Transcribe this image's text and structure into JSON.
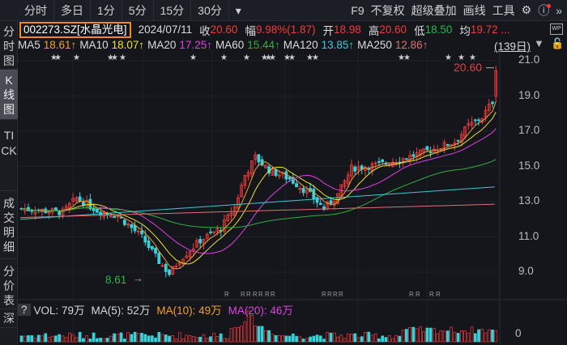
{
  "toolbar": {
    "periods": [
      "分时",
      "多日",
      "1分",
      "5分",
      "15分",
      "30分"
    ],
    "dropdown": "▾",
    "right": [
      "F9",
      "不复权",
      "超级叠加",
      "画线",
      "工具"
    ]
  },
  "sidebar": [
    "分时图",
    "K线图",
    "TICK",
    "成交明细",
    "分价表",
    "深"
  ],
  "quote": {
    "code": "002273.SZ[水晶光电]",
    "date": "2024/07/11",
    "close_label": "收",
    "close": "20.60",
    "change_label": "幅",
    "change": "9.98%(1.87)",
    "open_label": "开",
    "open": "18.98",
    "high_label": "高",
    "high": "20.60",
    "low_label": "低",
    "low": "18.50",
    "avg_label": "均",
    "avg": "19.72 ..."
  },
  "ma": [
    {
      "label": "MA5",
      "value": "18.61↑",
      "color": "#f0a030"
    },
    {
      "label": "MA10",
      "value": "18.07↑",
      "color": "#f0e030"
    },
    {
      "label": "MA20",
      "value": "17.25↑",
      "color": "#e040e0"
    },
    {
      "label": "MA60",
      "value": "15.44↑",
      "color": "#30b040"
    },
    {
      "label": "MA120",
      "value": "13.85↑",
      "color": "#40c8d8"
    },
    {
      "label": "MA250",
      "value": "12.86↑",
      "color": "#e07070"
    }
  ],
  "period_days": "(139日)",
  "price_axis": [
    "21.0",
    "19.0",
    "17.0",
    "15.0",
    "13.0",
    "11.0",
    "9.0"
  ],
  "annotations": {
    "high": "20.60",
    "low": "8.61"
  },
  "volume": {
    "help": "?",
    "vol": "VOL: 79万",
    "ma5": "MA(5): 52万",
    "ma10": "MA(10): 49万",
    "ma20": "MA(20): 46万",
    "axis": "0"
  },
  "colors": {
    "up": "#f03c3c",
    "down": "#3ad0d8",
    "code_border": "#f08a24"
  }
}
